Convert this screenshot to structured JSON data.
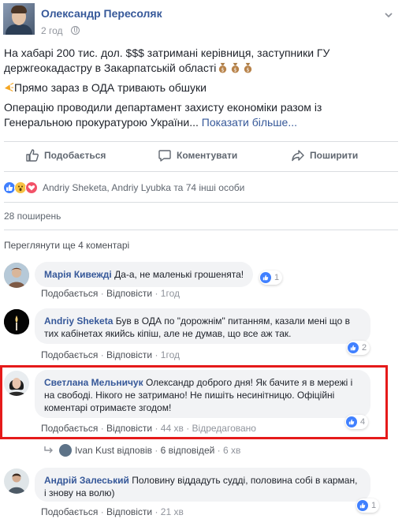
{
  "post": {
    "author": "Олександр Пересоляк",
    "time": "2 год",
    "line1": "На хабарі 200 тис. дол. $$$ затримані керівниця, заступники ГУ держгеокадастру в Закарпатській області",
    "line2": "Прямо зараз в ОДА тривають обшуки",
    "line3": "Операцію проводили департамент захисту економіки разом із Генеральною прокуратурою України...",
    "see_more": "Показати більше..."
  },
  "actions": {
    "like": "Подобається",
    "comment": "Коментувати",
    "share": "Поширити"
  },
  "reactions": {
    "names": "Andriy Sheketa, Andriy Lyubka та 74 інші особи",
    "shares": "28 поширень",
    "view_more": "Переглянути ще 4 коментарі"
  },
  "comments": [
    {
      "name": "Марія Кивежді",
      "text": "Да-а, не маленькі грошенята!",
      "like_label": "Подобається",
      "reply_label": "Відповісти",
      "time": "1год",
      "likes": "1",
      "edited": ""
    },
    {
      "name": "Andriy Sheketa",
      "text": "Був в ОДА по \"дорожнім\" питанням, казали мені що в тих кабінетах якийсь кіпіш, але не думав, що все аж так.",
      "like_label": "Подобається",
      "reply_label": "Відповісти",
      "time": "1год",
      "likes": "2",
      "edited": ""
    },
    {
      "name": "Светлана Мельничук",
      "text": "Олександр доброго дня! Як бачите я в мережі і на свободі. Нікого не затримано! Не пишіть несинітницю. Офіційні коментарі отримаєте згодом!",
      "like_label": "Подобається",
      "reply_label": "Відповісти",
      "time": "44 хв",
      "likes": "4",
      "edited": "Відредаговано"
    },
    {
      "name": "Андрій Залеський",
      "text": "Половину віддадуть судді, половина собі в карман, і знову на волю)",
      "like_label": "Подобається",
      "reply_label": "Відповісти",
      "time": "21 хв",
      "likes": "1",
      "edited": ""
    }
  ],
  "replies": {
    "who": "Ivan Kust відповів",
    "count": "6 відповідей",
    "time": "6 хв"
  },
  "colors": {
    "link": "#365899",
    "highlight": "#e51a1a",
    "like_blue": "#4080ff"
  }
}
